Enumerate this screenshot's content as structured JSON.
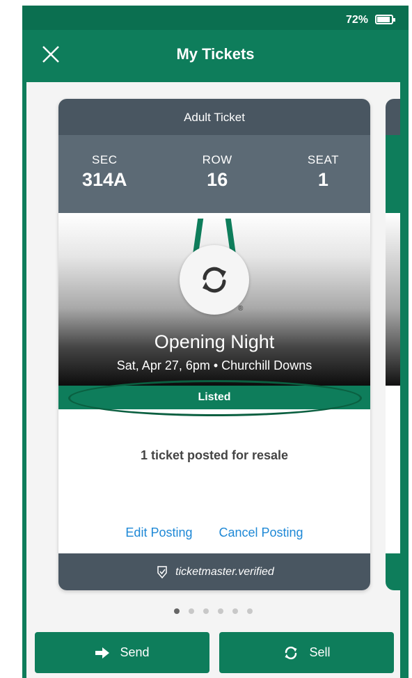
{
  "status": {
    "battery": "72%"
  },
  "nav": {
    "title": "My Tickets"
  },
  "ticket": {
    "type": "Adult Ticket",
    "section_label": "SEC",
    "section": "314A",
    "row_label": "ROW",
    "row": "16",
    "seat_label": "SEAT",
    "seat": "1",
    "event_name": "Opening Night",
    "event_details": "Sat, Apr 27, 6pm • Churchill Downs",
    "status": "Listed",
    "resale_message": "1 ticket posted for resale",
    "edit_label": "Edit Posting",
    "cancel_label": "Cancel Posting",
    "verified_label": "ticketmaster.verified"
  },
  "pager": {
    "count": 6,
    "active": 0
  },
  "actions": {
    "send_label": "Send",
    "sell_label": "Sell"
  },
  "colors": {
    "brand": "#0e7d5b",
    "slate": "#495661",
    "link": "#1e88d6"
  },
  "icons": [
    "close-icon",
    "refresh-icon",
    "arrow-right-icon",
    "sync-icon",
    "verified-badge-icon",
    "battery-icon"
  ]
}
